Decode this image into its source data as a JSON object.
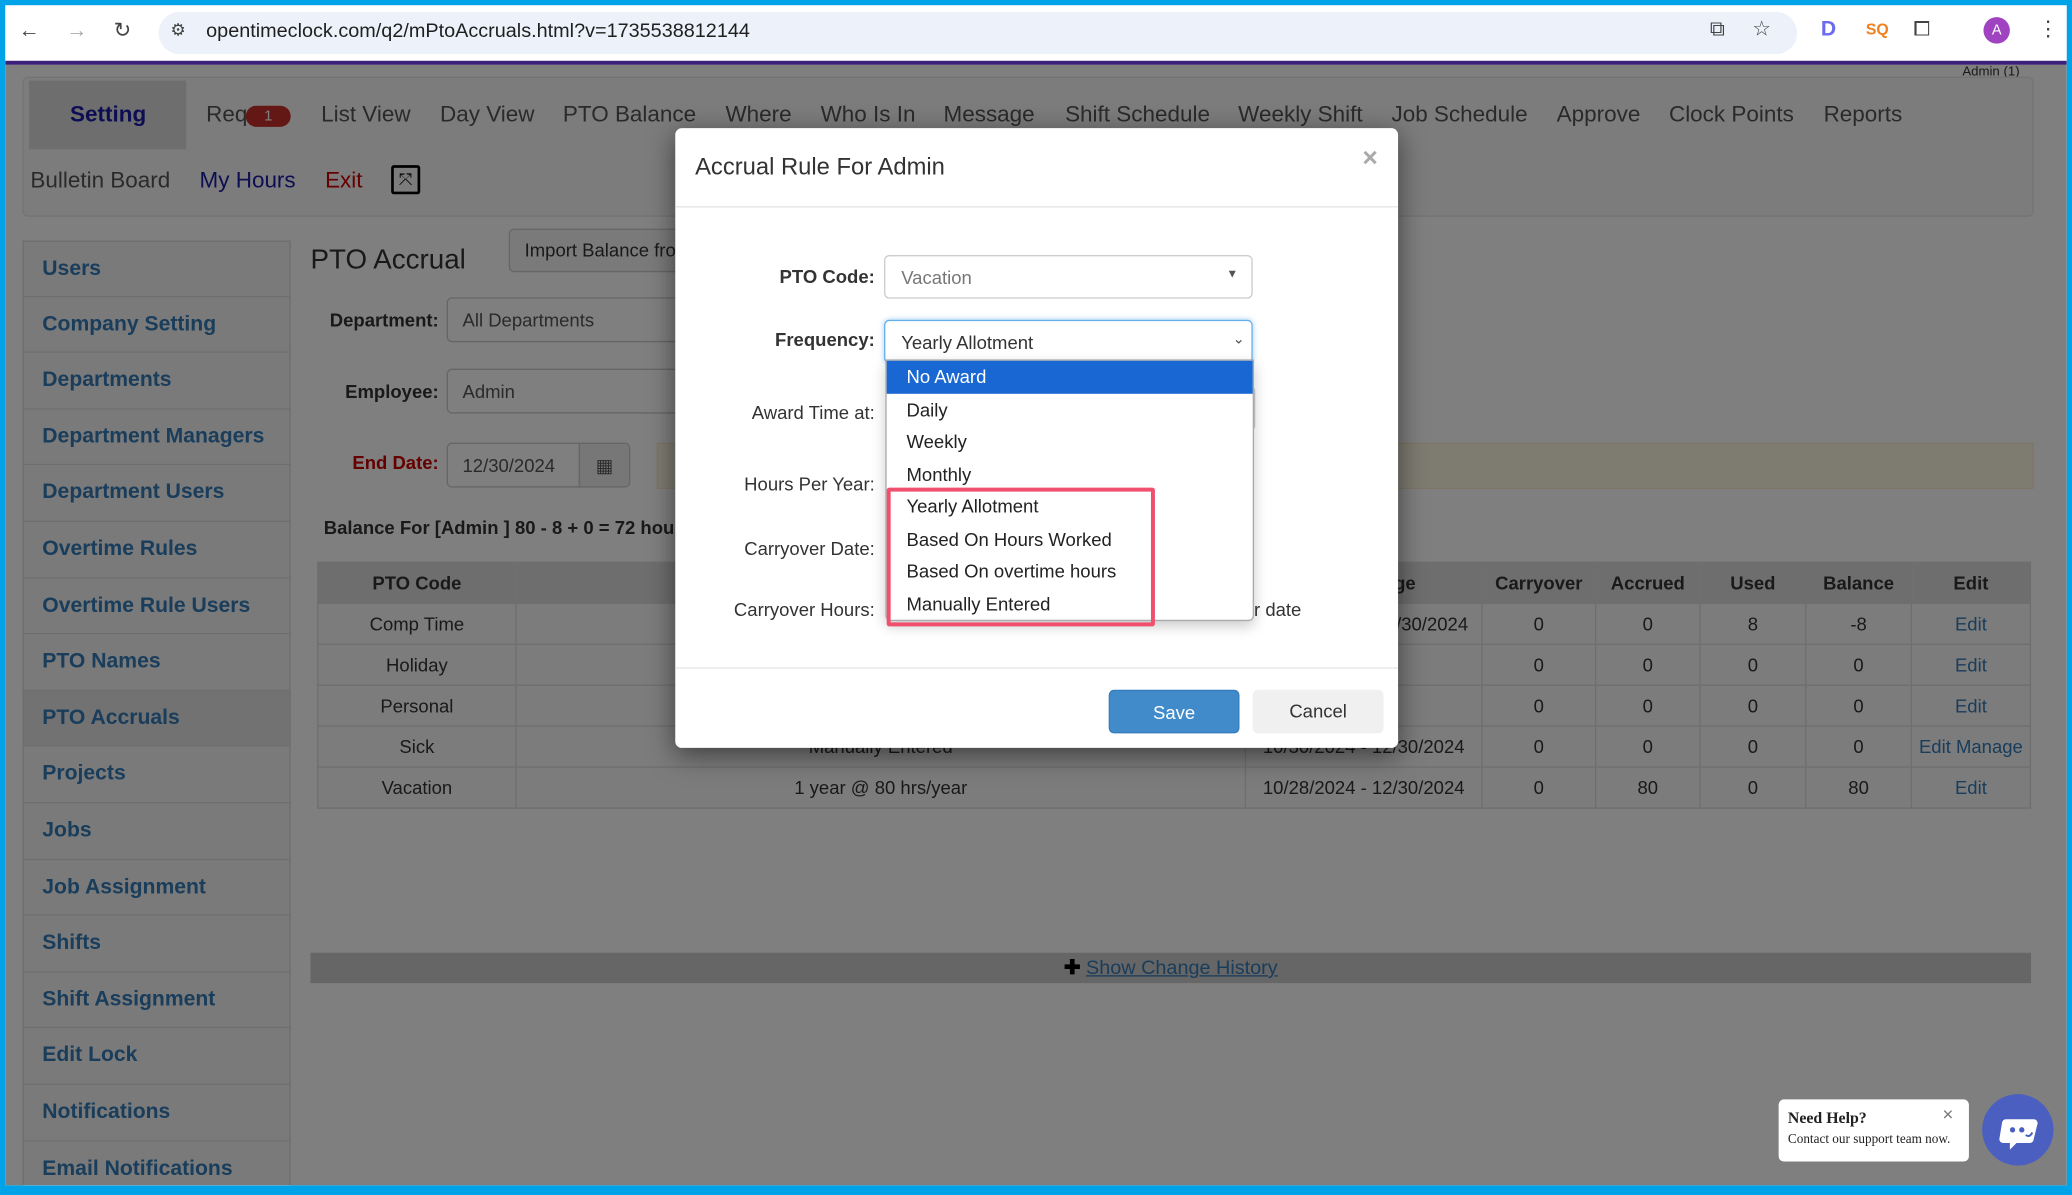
{
  "browser": {
    "url": "opentimeclock.com/q2/mPtoAccruals.html?v=1735538812144",
    "profile_initial": "A",
    "ext_sq": "SQ",
    "ext_d": "D"
  },
  "user": "Admin (1)",
  "nav": {
    "row1": [
      "Setting",
      "Req",
      "List View",
      "Day View",
      "PTO Balance",
      "Where",
      "Who Is In",
      "Message",
      "Shift Schedule",
      "Weekly Shift",
      "Job Schedule",
      "Approve",
      "Clock Points",
      "Reports"
    ],
    "req_badge": "1",
    "row2": {
      "bulletin": "Bulletin Board",
      "my_hours": "My Hours",
      "exit": "Exit"
    }
  },
  "sidebar": [
    "Users",
    "Company Setting",
    "Departments",
    "Department Managers",
    "Department Users",
    "Overtime Rules",
    "Overtime Rule Users",
    "PTO Names",
    "PTO Accruals",
    "Projects",
    "Jobs",
    "Job Assignment",
    "Shifts",
    "Shift Assignment",
    "Edit Lock",
    "Notifications",
    "Email Notifications"
  ],
  "main": {
    "title": "PTO Accrual",
    "import_button": "Import Balance fro",
    "department_label": "Department:",
    "department_value": "All Departments",
    "employee_label": "Employee:",
    "employee_value": "Admin",
    "end_date_label": "End Date:",
    "end_date_value": "12/30/2024",
    "balance_text": "Balance For [Admin ] 80 - 8 + 0 = 72 hou",
    "show_history": "Show Change History"
  },
  "table": {
    "headers": [
      "PTO Code",
      "",
      "ge",
      "Carryover",
      "Accrued",
      "Used",
      "Balance",
      "Edit"
    ],
    "rows": [
      {
        "code": "Comp Time",
        "rule": "",
        "range": "/30/2024",
        "carryover": "0",
        "accrued": "0",
        "used": "8",
        "balance": "-8",
        "edit": "Edit",
        "manage": ""
      },
      {
        "code": "Holiday",
        "rule": "",
        "range": "",
        "carryover": "0",
        "accrued": "0",
        "used": "0",
        "balance": "0",
        "edit": "Edit",
        "manage": ""
      },
      {
        "code": "Personal",
        "rule": "",
        "range": "",
        "carryover": "0",
        "accrued": "0",
        "used": "0",
        "balance": "0",
        "edit": "Edit",
        "manage": ""
      },
      {
        "code": "Sick",
        "rule": "Manually Entered",
        "range": "10/30/2024 - 12/30/2024",
        "carryover": "0",
        "accrued": "0",
        "used": "0",
        "balance": "0",
        "edit": "Edit",
        "manage": "Manage"
      },
      {
        "code": "Vacation",
        "rule": "1 year @ 80 hrs/year",
        "range": "10/28/2024 - 12/30/2024",
        "carryover": "0",
        "accrued": "80",
        "used": "0",
        "balance": "80",
        "edit": "Edit",
        "manage": ""
      }
    ]
  },
  "modal": {
    "title": "Accrual Rule For Admin",
    "close": "×",
    "pto_code_label": "PTO Code:",
    "pto_code_value": "Vacation",
    "frequency_label": "Frequency:",
    "frequency_value": "Yearly Allotment",
    "award_label": "Award Time at:",
    "hours_label": "Hours Per Year:",
    "carry_date_label": "Carryover Date:",
    "carry_hours_label": "Carryover Hours:",
    "carry_hours_suffix": "r date",
    "save": "Save",
    "cancel": "Cancel",
    "options": [
      "No Award",
      "Daily",
      "Weekly",
      "Monthly",
      "Yearly Allotment",
      "Based On Hours Worked",
      "Based On overtime hours",
      "Manually Entered"
    ],
    "highlighted_option": "No Award"
  },
  "help": {
    "title": "Need Help?",
    "text": "Contact our support team now.",
    "close": "×"
  },
  "colors": {
    "frame": "#00a2e8",
    "accent": "#337ab7",
    "selected_option": "#1967d2",
    "highlight_box": "#f0506e",
    "save": "#428bca",
    "chat": "#4b5fc1"
  }
}
